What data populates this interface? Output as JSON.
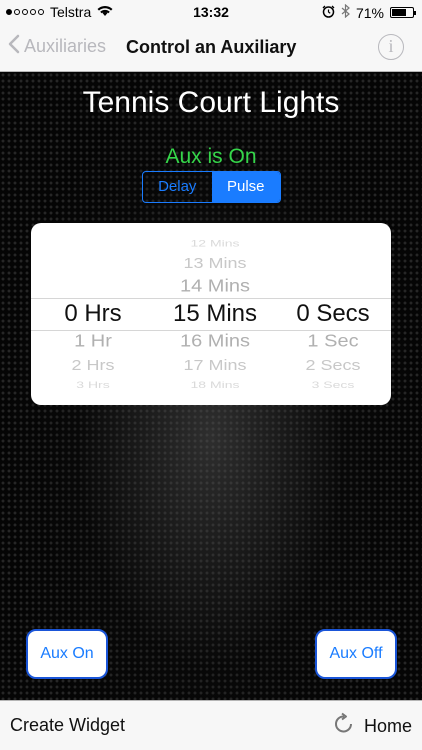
{
  "status_bar": {
    "carrier": "Telstra",
    "time": "13:32",
    "battery": "71%",
    "battery_level": 0.71,
    "signal_bars": 1,
    "icons": [
      "wifi-icon",
      "alarm-icon",
      "bluetooth-icon",
      "battery-icon"
    ]
  },
  "nav": {
    "back_label": "Auxiliaries",
    "title": "Control an Auxiliary",
    "info_glyph": "i"
  },
  "main": {
    "title": "Tennis Court Lights",
    "status": "Aux is On",
    "segments": [
      "Delay",
      "Pulse"
    ],
    "selected_segment": "Pulse"
  },
  "picker": {
    "hours": {
      "above": [
        "",
        "",
        ""
      ],
      "selected": "0 Hrs",
      "below": [
        "1 Hr",
        "2 Hrs",
        "3 Hrs"
      ]
    },
    "mins": {
      "above": [
        "12 Mins",
        "13 Mins",
        "14 Mins"
      ],
      "selected": "15 Mins",
      "below": [
        "16 Mins",
        "17 Mins",
        "18 Mins"
      ]
    },
    "secs": {
      "above": [
        "",
        "",
        ""
      ],
      "selected": "0 Secs",
      "below": [
        "1 Sec",
        "2 Secs",
        "3 Secs"
      ]
    }
  },
  "buttons": {
    "aux_on": "Aux On",
    "aux_off": "Aux Off"
  },
  "toolbar": {
    "create_widget": "Create Widget",
    "home": "Home"
  },
  "colors": {
    "accent": "#1a7cff",
    "status_on": "#35d64a",
    "button_border": "#1a55d8"
  }
}
